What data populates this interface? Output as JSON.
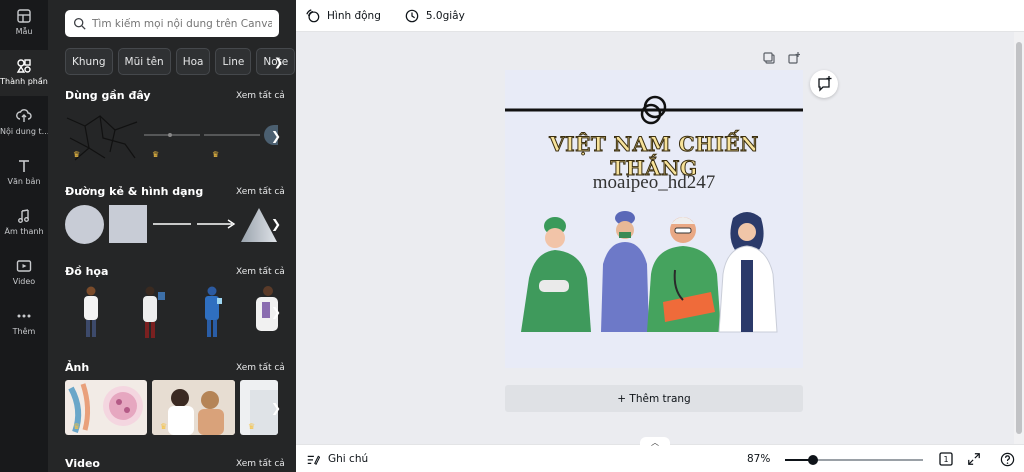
{
  "rail": {
    "items": [
      {
        "label": "Mẫu",
        "icon": "template-icon"
      },
      {
        "label": "Thành phần",
        "icon": "elements-icon"
      },
      {
        "label": "Nội dung t...",
        "icon": "upload-icon"
      },
      {
        "label": "Văn bản",
        "icon": "text-icon"
      },
      {
        "label": "Âm thanh",
        "icon": "music-icon"
      },
      {
        "label": "Video",
        "icon": "video-icon"
      },
      {
        "label": "Thêm",
        "icon": "more-icon"
      }
    ],
    "active_index": 1
  },
  "panel": {
    "search_placeholder": "Tìm kiếm mọi nội dung trên Canva",
    "chips": [
      "Khung",
      "Mũi tên",
      "Hoa",
      "Line",
      "Note"
    ],
    "sections": {
      "recent": {
        "title": "Dùng gần đây",
        "see_all": "Xem tất cả"
      },
      "lines_shapes": {
        "title": "Đường kẻ & hình dạng",
        "see_all": "Xem tất cả"
      },
      "graphics": {
        "title": "Đồ họa",
        "see_all": "Xem tất cả"
      },
      "photos": {
        "title": "Ảnh",
        "see_all": "Xem tất cả"
      },
      "video": {
        "title": "Video",
        "see_all": "Xem tất cả"
      }
    }
  },
  "topbar": {
    "animate_label": "Hình động",
    "duration_label": "5.0giây"
  },
  "canvas": {
    "title": "VIỆT NAM CHIẾN THẮNG",
    "subtitle": "moaipeo_hd247",
    "add_page_label": "+ Thêm trang"
  },
  "bottombar": {
    "notes_label": "Ghi chú",
    "zoom_label": "87%",
    "zoom_value": 0.2,
    "page_count": "1"
  },
  "colors": {
    "rail_bg": "#18191b",
    "panel_bg": "#252627",
    "page_bg": "#e8ebf7",
    "title_fill": "#f7e29a",
    "crown": "#f6c344"
  }
}
